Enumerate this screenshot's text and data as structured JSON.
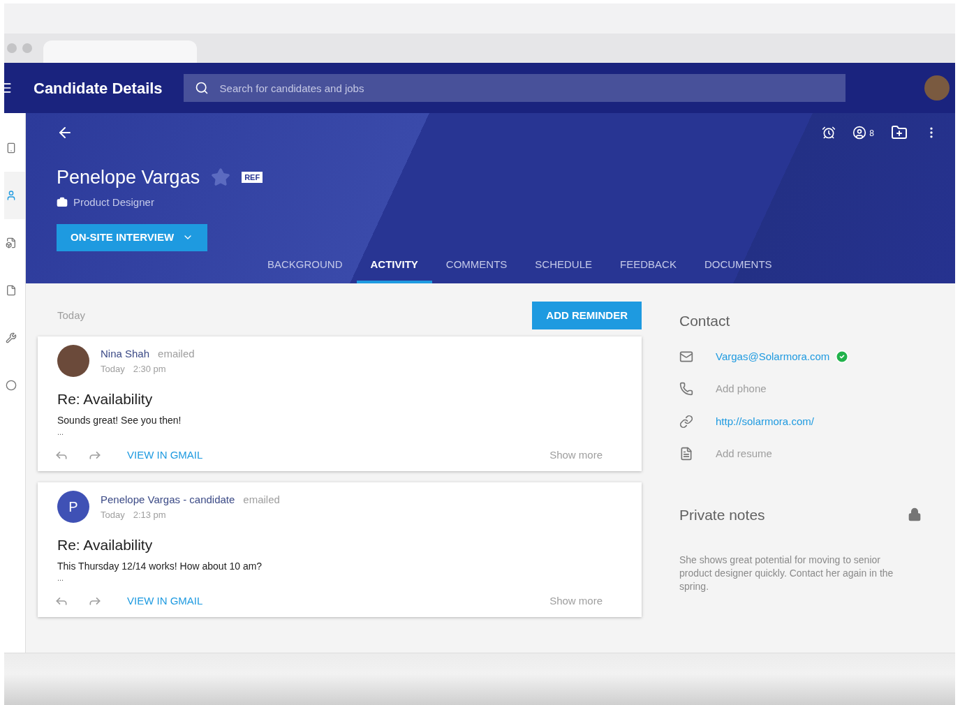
{
  "app_bar": {
    "title": "Candidate Details",
    "search": {
      "placeholder": "Search for candidates and jobs"
    }
  },
  "sidebar": {
    "items": [
      {
        "kind": "phone",
        "selected": false
      },
      {
        "kind": "person",
        "selected": true
      },
      {
        "kind": "doc",
        "selected": false
      },
      {
        "kind": "file",
        "selected": false
      },
      {
        "kind": "tool",
        "selected": false
      },
      {
        "kind": "dot",
        "selected": false
      }
    ]
  },
  "candidate": {
    "name": "Penelope Vargas",
    "starred": false,
    "badge": "REF",
    "role": "Product Designer",
    "stage": "ON-SITE INTERVIEW",
    "followers": "8"
  },
  "tabs": [
    {
      "label": "BACKGROUND",
      "selected": false
    },
    {
      "label": "ACTIVITY",
      "selected": true
    },
    {
      "label": "COMMENTS",
      "selected": false
    },
    {
      "label": "SCHEDULE",
      "selected": false
    },
    {
      "label": "FEEDBACK",
      "selected": false
    },
    {
      "label": "DOCUMENTS",
      "selected": false
    }
  ],
  "activity": {
    "day": "Today",
    "add_button": "ADD REMINDER",
    "emails": [
      {
        "kind": "photo",
        "sender": "Nina Shah",
        "verb": "emailed",
        "date": "Today",
        "time": "2:30 pm",
        "subject": "Re: Availability",
        "body": "Sounds great! See you then!",
        "ellipsis": "...",
        "link": "VIEW IN GMAIL",
        "more": "Show more"
      },
      {
        "kind": "letter",
        "letter": "P",
        "sender": "Penelope Vargas - candidate",
        "verb": "emailed",
        "date": "Today",
        "time": "2:13 pm",
        "subject": "Re: Availability",
        "body": "This Thursday 12/14 works! How about 10 am?",
        "ellipsis": "...",
        "link": "VIEW IN GMAIL",
        "more": "Show more"
      }
    ]
  },
  "contact": {
    "title": "Contact",
    "items": [
      {
        "kind": "email",
        "text": "Vargas@Solarmora.com",
        "link": true,
        "verified": true
      },
      {
        "kind": "phone",
        "text": "Add phone",
        "link": false,
        "verified": false
      },
      {
        "kind": "website",
        "text": "http://solarmora.com/",
        "link": true,
        "verified": false
      },
      {
        "kind": "resume",
        "text": "Add resume",
        "link": false,
        "verified": false
      }
    ]
  },
  "notes": {
    "title": "Private notes",
    "text": "She shows great potential for moving to senior product designer quickly. Contact her again in the spring."
  }
}
